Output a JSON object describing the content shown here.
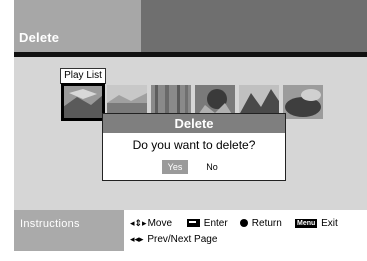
{
  "header": {
    "title": "Delete"
  },
  "playlist": {
    "label": "Play List",
    "thumbnails": [
      {
        "name": "thumbnail-1",
        "selected": true
      },
      {
        "name": "thumbnail-2",
        "selected": false
      },
      {
        "name": "thumbnail-3",
        "selected": false
      },
      {
        "name": "thumbnail-4",
        "selected": false
      },
      {
        "name": "thumbnail-5",
        "selected": false
      },
      {
        "name": "thumbnail-6",
        "selected": false
      }
    ]
  },
  "dialog": {
    "title": "Delete",
    "message": "Do you want to delete?",
    "yes_label": "Yes",
    "no_label": "No",
    "selected": "Yes"
  },
  "footer": {
    "instructions_label": "Instructions",
    "move_icon": "◂⇕▸",
    "move_label": "Move",
    "enter_label": "Enter",
    "return_label": "Return",
    "menu_badge": "Menu",
    "exit_label": "Exit",
    "page_icon": "◂◂▸",
    "page_label": "Prev/Next Page"
  },
  "colors": {
    "header_right": "#6f6f6f",
    "content_bg": "#d6d6d6",
    "dialog_title_bg": "#7f7f7f",
    "selected_button": "#9a9a9a"
  }
}
